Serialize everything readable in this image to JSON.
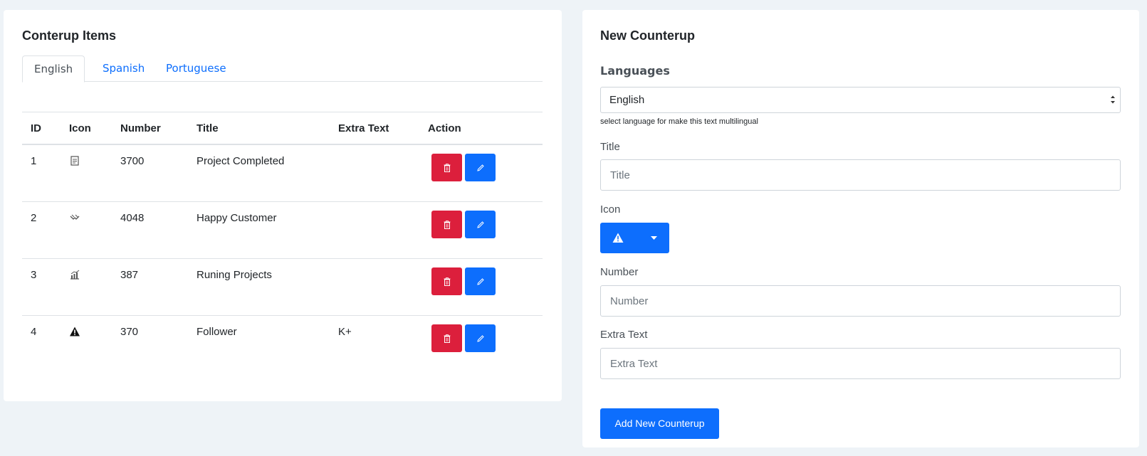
{
  "left": {
    "title": "Conterup Items",
    "tabs": [
      {
        "label": "English",
        "active": true
      },
      {
        "label": "Spanish",
        "active": false
      },
      {
        "label": "Portuguese",
        "active": false
      }
    ],
    "table": {
      "headers": [
        "ID",
        "Icon",
        "Number",
        "Title",
        "Extra Text",
        "Action"
      ],
      "rows": [
        {
          "id": "1",
          "icon": "clipboard-icon",
          "number": "3700",
          "title": "Project Completed",
          "extra": ""
        },
        {
          "id": "2",
          "icon": "handshake-icon",
          "number": "4048",
          "title": "Happy Customer",
          "extra": ""
        },
        {
          "id": "3",
          "icon": "chart-icon",
          "number": "387",
          "title": "Runing Projects",
          "extra": ""
        },
        {
          "id": "4",
          "icon": "warning-icon",
          "number": "370",
          "title": "Follower",
          "extra": "K+"
        }
      ]
    }
  },
  "right": {
    "title": "New Counterup",
    "languages_label": "Languages",
    "language_select": "English",
    "language_help": "select language for make this text multilingual",
    "title_label": "Title",
    "title_placeholder": "Title",
    "icon_label": "Icon",
    "icon_selected": "warning-icon",
    "number_label": "Number",
    "number_placeholder": "Number",
    "extra_label": "Extra Text",
    "extra_placeholder": "Extra Text",
    "submit_label": "Add New Counterup"
  },
  "colors": {
    "primary": "#0d6efd",
    "danger": "#dc1f3c",
    "background": "#eef3f7"
  }
}
